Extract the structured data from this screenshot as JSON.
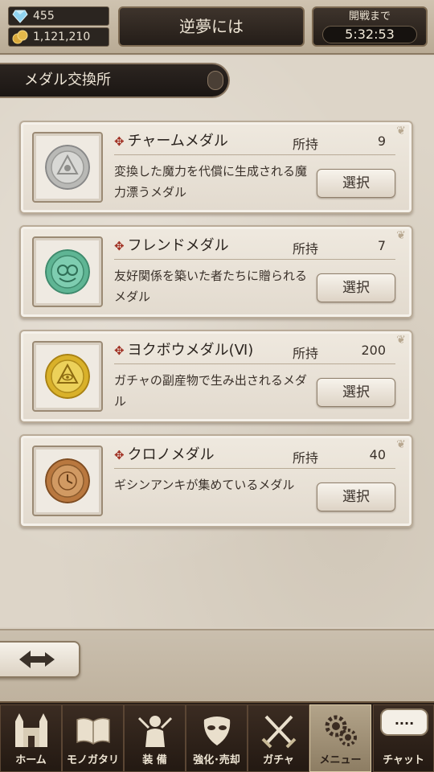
{
  "status": {
    "gems": "455",
    "coins": "1,121,210",
    "title": "逆夢には",
    "timer_label": "開戦まで",
    "timer_value": "5:32:53"
  },
  "header": {
    "title": "メダル交換所"
  },
  "medals": [
    {
      "name": "チャームメダル",
      "own_label": "所持",
      "count": "9",
      "desc": "変換した魔力を代償に生成される魔力漂うメダル",
      "select_label": "選択",
      "color": "#c9c9c6"
    },
    {
      "name": "フレンドメダル",
      "own_label": "所持",
      "count": "7",
      "desc": "友好関係を築いた者たちに贈られるメダル",
      "select_label": "選択",
      "color": "#6cbfa1"
    },
    {
      "name": "ヨクボウメダル(Ⅵ)",
      "own_label": "所持",
      "count": "200",
      "desc": "ガチャの副産物で生み出されるメダル",
      "select_label": "選択",
      "color": "#e2c034"
    },
    {
      "name": "クロノメダル",
      "own_label": "所持",
      "count": "40",
      "desc": "ギシンアンキが集めているメダル",
      "select_label": "選択",
      "color": "#c58c55"
    }
  ],
  "nav": [
    {
      "label": "ホーム",
      "icon": "castle-icon"
    },
    {
      "label": "モノガタリ",
      "icon": "book-icon"
    },
    {
      "label": "装 備",
      "icon": "equipment-icon"
    },
    {
      "label": "強化･売却",
      "icon": "mask-icon"
    },
    {
      "label": "ガチャ",
      "icon": "swords-icon"
    },
    {
      "label": "メニュー",
      "icon": "gears-icon",
      "active": true
    }
  ],
  "chat": {
    "bubble": "....",
    "label": "チャット"
  },
  "colors": {
    "accent_red": "#9e2b1e",
    "dark_plate": "#241d18",
    "paper": "#ddd5c8"
  }
}
